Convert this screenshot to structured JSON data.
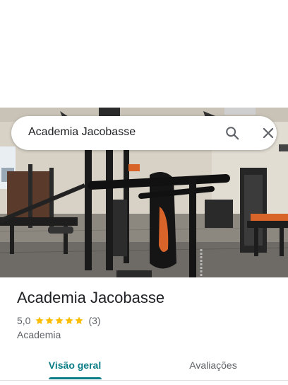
{
  "search": {
    "query": "Academia Jacobasse"
  },
  "place": {
    "name": "Academia Jacobasse",
    "rating": "5,0",
    "stars": 5,
    "review_count": "(3)",
    "category": "Academia"
  },
  "tabs": [
    {
      "label": "Visão geral",
      "selected": true
    },
    {
      "label": "Avaliações",
      "selected": false
    }
  ],
  "colors": {
    "accent": "#0b7d86",
    "star": "#fbbc04",
    "text_primary": "#202124",
    "text_secondary": "#5f6368"
  },
  "icons": {
    "search": "search-icon",
    "close": "close-icon",
    "star": "star-icon"
  }
}
